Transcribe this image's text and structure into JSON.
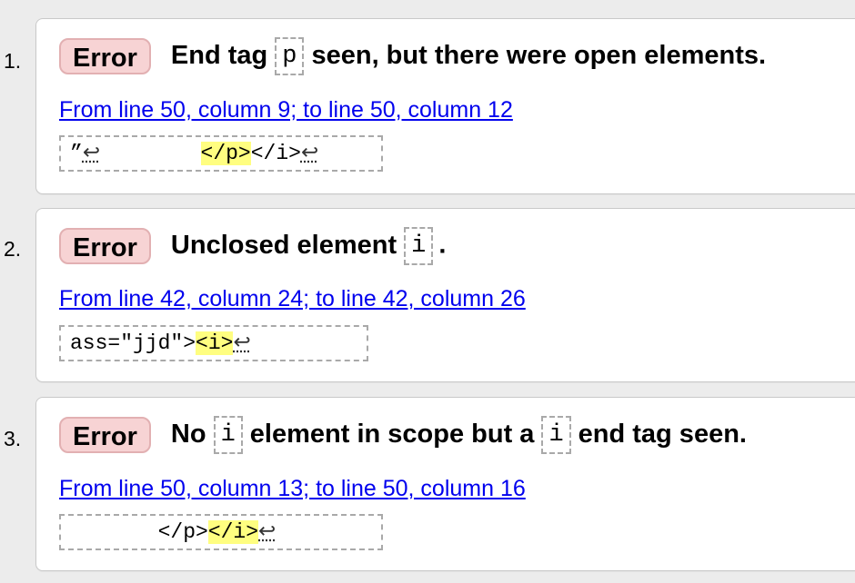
{
  "messages": [
    {
      "number": "1.",
      "type_label": "Error",
      "text_before": "End tag",
      "code1": "p",
      "text_after": "seen, but there were open elements.",
      "location": "From line 50, column 9; to line 50, column 12",
      "extract_pre": "”",
      "extract_lf1": "↩",
      "extract_mid": "        ",
      "extract_highlight": "</p>",
      "extract_post": "</i>",
      "extract_lf2": "↩"
    },
    {
      "number": "2.",
      "type_label": "Error",
      "text_before": "Unclosed element",
      "code1": "i",
      "text_after": ".",
      "location": "From line 42, column 24; to line 42, column 26",
      "extract_pre": "ass=\"jjd\">",
      "extract_highlight": "<i>",
      "extract_lf": "↩"
    },
    {
      "number": "3.",
      "type_label": "Error",
      "text_before": "No",
      "code1": "i",
      "text_middle": "element in scope but a",
      "code2": "i",
      "text_after": "end tag seen.",
      "location": "From line 50, column 13; to line 50, column 16",
      "extract_pre": "       </p>",
      "extract_highlight": "</i>",
      "extract_lf": "↩"
    }
  ]
}
